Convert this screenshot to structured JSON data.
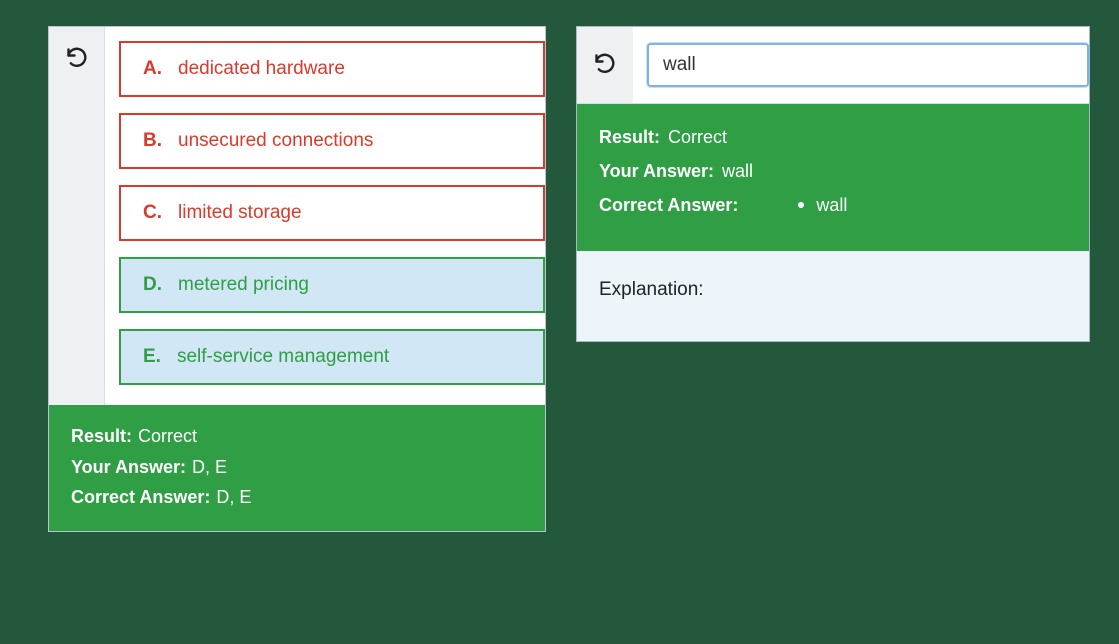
{
  "panel1": {
    "options": [
      {
        "letter": "A.",
        "text": "dedicated hardware",
        "state": "wrong"
      },
      {
        "letter": "B.",
        "text": "unsecured connections",
        "state": "wrong"
      },
      {
        "letter": "C.",
        "text": "limited storage",
        "state": "wrong"
      },
      {
        "letter": "D.",
        "text": "metered pricing",
        "state": "correct"
      },
      {
        "letter": "E.",
        "text": "self-service management",
        "state": "correct"
      }
    ],
    "result_label": "Result:",
    "result_value": "Correct",
    "your_answer_label": "Your Answer:",
    "your_answer_value": "D, E",
    "correct_answer_label": "Correct Answer:",
    "correct_answer_value": "D, E"
  },
  "panel2": {
    "input_value": "wall",
    "result_label": "Result:",
    "result_value": "Correct",
    "your_answer_label": "Your Answer:",
    "your_answer_value": "wall",
    "correct_answer_label": "Correct Answer:",
    "correct_answer_value": "wall",
    "explanation_label": "Explanation:"
  },
  "icons": {
    "undo": "undo-icon"
  }
}
